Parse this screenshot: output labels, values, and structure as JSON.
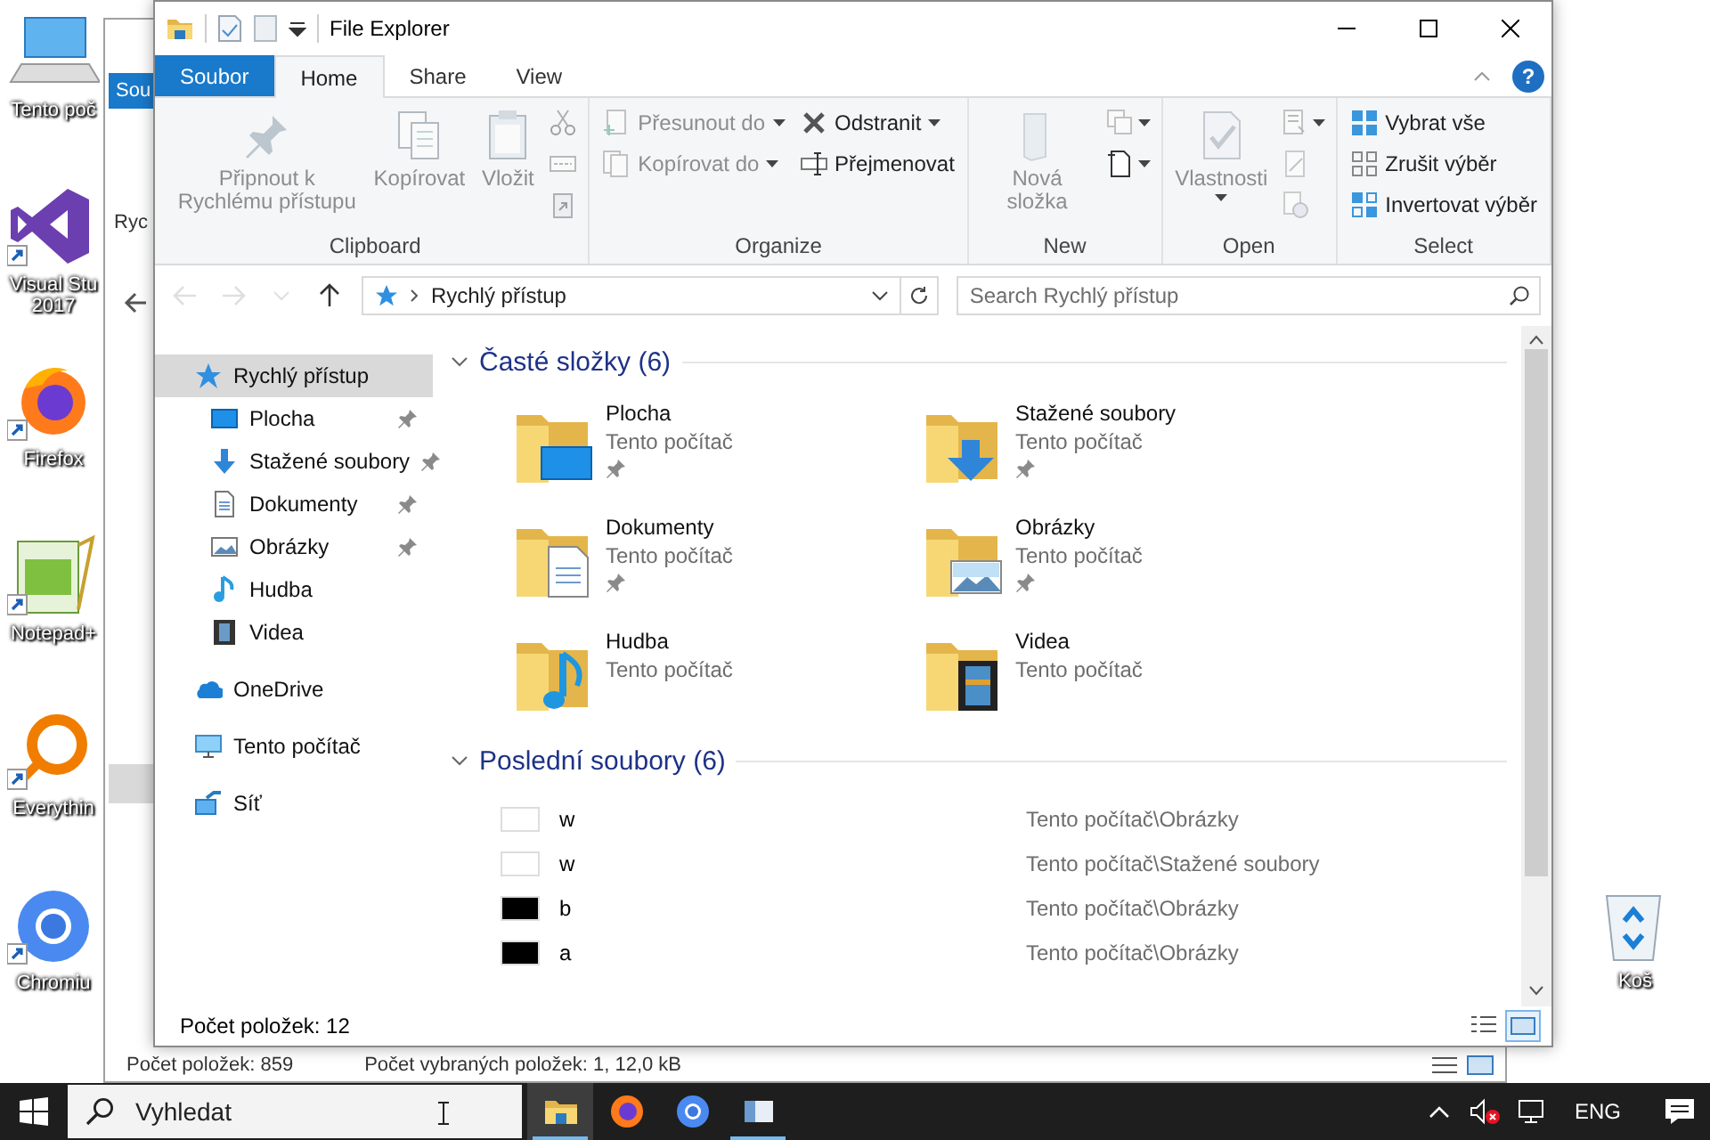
{
  "desktop": {
    "left_icons": [
      {
        "kind": "computer",
        "label": "Tento poč"
      },
      {
        "kind": "visual-studio",
        "label": "Visual Stu 2017"
      },
      {
        "kind": "firefox",
        "label": "Firefox"
      },
      {
        "kind": "notepad",
        "label": "Notepad+"
      },
      {
        "kind": "everything",
        "label": "Everythin"
      },
      {
        "kind": "chromium",
        "label": "Chromiu"
      }
    ],
    "right_icons": [
      {
        "kind": "recycle-bin",
        "label": "Koš"
      }
    ]
  },
  "back_window": {
    "tab": "Sou",
    "nav_label": "Ryc",
    "status": [
      "Počet položek: 859",
      "Počet vybraných položek: 1, 12,0 kB"
    ]
  },
  "window": {
    "title": "File Explorer",
    "tabs": [
      {
        "label": "Soubor",
        "kind": "file",
        "selected": false
      },
      {
        "label": "Home",
        "kind": "tab",
        "selected": true
      },
      {
        "label": "Share",
        "kind": "tab",
        "selected": false
      },
      {
        "label": "View",
        "kind": "tab",
        "selected": false
      }
    ],
    "help_label": "?",
    "ribbon": [
      {
        "label": "Clipboard",
        "columns": [
          [
            {
              "kind": "large",
              "label": "Připnout k Rychlému přístupu",
              "disabled": true,
              "dropdown": false
            }
          ],
          [
            {
              "kind": "large",
              "label": "Kopírovat",
              "disabled": true,
              "dropdown": false
            }
          ],
          [
            {
              "kind": "large",
              "label": "Vložit",
              "disabled": true,
              "dropdown": false
            }
          ],
          [
            {
              "kind": "icon",
              "disabled": true,
              "dropdown": false
            },
            {
              "kind": "icon",
              "disabled": true,
              "dropdown": false
            },
            {
              "kind": "icon",
              "disabled": true,
              "dropdown": false
            }
          ]
        ]
      },
      {
        "label": "Organize",
        "columns": [
          [
            {
              "kind": "small",
              "label": "Přesunout do",
              "disabled": true,
              "dropdown": true
            },
            {
              "kind": "small",
              "label": "Kopírovat do",
              "disabled": true,
              "dropdown": true
            }
          ],
          [
            {
              "kind": "small",
              "label": "Odstranit",
              "disabled": false,
              "dropdown": true
            },
            {
              "kind": "small",
              "label": "Přejmenovat",
              "disabled": false,
              "dropdown": false
            }
          ]
        ]
      },
      {
        "label": "New",
        "columns": [
          [
            {
              "kind": "large",
              "label": "Nová složka",
              "disabled": true,
              "dropdown": false
            }
          ],
          [
            {
              "kind": "icon",
              "disabled": true,
              "dropdown": true
            },
            {
              "kind": "icon",
              "disabled": false,
              "dropdown": true
            }
          ]
        ]
      },
      {
        "label": "Open",
        "columns": [
          [
            {
              "kind": "large",
              "label": "Vlastnosti",
              "disabled": true,
              "dropdown": true
            }
          ],
          [
            {
              "kind": "icon",
              "disabled": true,
              "dropdown": true
            },
            {
              "kind": "icon",
              "disabled": true,
              "dropdown": false
            },
            {
              "kind": "icon",
              "disabled": true,
              "dropdown": false
            }
          ]
        ]
      },
      {
        "label": "Select",
        "columns": [
          [
            {
              "kind": "small",
              "label": "Vybrat vše",
              "disabled": false,
              "dropdown": false
            },
            {
              "kind": "small",
              "label": "Zrušit výběr",
              "disabled": false,
              "dropdown": false
            },
            {
              "kind": "small",
              "label": "Invertovat výběr",
              "disabled": false,
              "dropdown": false
            }
          ]
        ]
      }
    ],
    "nav_buttons": [
      {
        "kind": "back",
        "disabled": true
      },
      {
        "kind": "forward",
        "disabled": true
      },
      {
        "kind": "recent",
        "disabled": true
      },
      {
        "kind": "up",
        "disabled": false
      }
    ],
    "address": {
      "location": "Rychlý přístup",
      "search_placeholder": "Search Rychlý přístup"
    },
    "nav_tree": [
      {
        "label": "Rychlý přístup",
        "kind": "quick",
        "selected": true,
        "children": [
          {
            "label": "Plocha",
            "kind": "desktop",
            "pinned": true,
            "selected": false
          },
          {
            "label": "Stažené soubory",
            "kind": "downloads",
            "pinned": true,
            "selected": false
          },
          {
            "label": "Dokumenty",
            "kind": "documents",
            "pinned": true,
            "selected": false
          },
          {
            "label": "Obrázky",
            "kind": "pictures",
            "pinned": true,
            "selected": false
          },
          {
            "label": "Hudba",
            "kind": "music",
            "pinned": false,
            "selected": false
          },
          {
            "label": "Videa",
            "kind": "videos",
            "pinned": false,
            "selected": false
          }
        ]
      },
      {
        "label": "OneDrive",
        "kind": "onedrive",
        "selected": false
      },
      {
        "label": "Tento počítač",
        "kind": "pc",
        "selected": false
      },
      {
        "label": "Síť",
        "kind": "network",
        "selected": false
      }
    ],
    "sections": [
      {
        "title": "Časté složky (6)",
        "kind": "folders",
        "expanded": true,
        "items": [
          {
            "name": "Plocha",
            "location": "Tento počítač",
            "kind": "desktop",
            "pinned": true
          },
          {
            "name": "Stažené soubory",
            "location": "Tento počítač",
            "kind": "downloads",
            "pinned": true
          },
          {
            "name": "Dokumenty",
            "location": "Tento počítač",
            "kind": "documents",
            "pinned": true
          },
          {
            "name": "Obrázky",
            "location": "Tento počítač",
            "kind": "pictures",
            "pinned": true
          },
          {
            "name": "Hudba",
            "location": "Tento počítač",
            "kind": "music",
            "pinned": false
          },
          {
            "name": "Videa",
            "location": "Tento počítač",
            "kind": "videos",
            "pinned": false
          }
        ]
      },
      {
        "title": "Poslední soubory (6)",
        "kind": "files",
        "expanded": true,
        "items": [
          {
            "name": "w",
            "path": "Tento počítač\\Obrázky",
            "color": "#ffffff"
          },
          {
            "name": "w",
            "path": "Tento počítač\\Stažené soubory",
            "color": "#ffffff"
          },
          {
            "name": "b",
            "path": "Tento počítač\\Obrázky",
            "color": "#000000"
          },
          {
            "name": "a",
            "path": "Tento počítač\\Obrázky",
            "color": "#000000"
          }
        ]
      }
    ],
    "status": {
      "count": "Počet položek: 12",
      "views": [
        {
          "kind": "details",
          "selected": false
        },
        {
          "kind": "tiles",
          "selected": true
        }
      ]
    }
  },
  "taskbar": {
    "search_placeholder": "Vyhledat",
    "apps": [
      {
        "kind": "explorer",
        "selected": true,
        "running": true
      },
      {
        "kind": "firefox",
        "selected": false,
        "running": false
      },
      {
        "kind": "chromium",
        "selected": false,
        "running": false
      },
      {
        "kind": "app",
        "selected": false,
        "running": true
      }
    ],
    "language": "ENG"
  }
}
